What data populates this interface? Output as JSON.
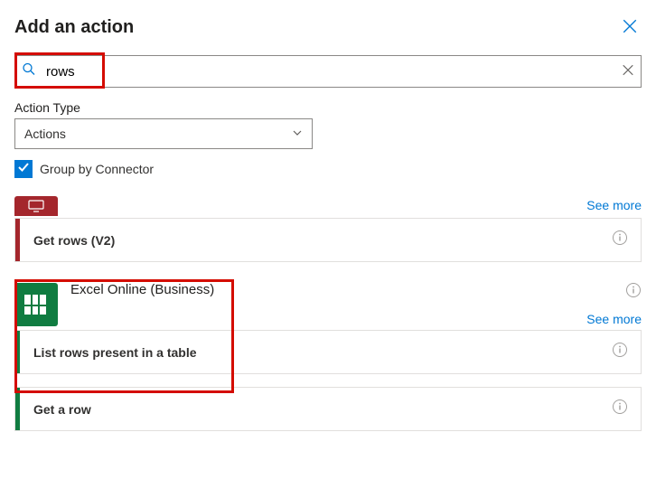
{
  "header": {
    "title": "Add an action"
  },
  "search": {
    "value": "rows"
  },
  "actionType": {
    "label": "Action Type",
    "selected": "Actions"
  },
  "groupBy": {
    "label": "Group by Connector",
    "checked": true
  },
  "links": {
    "seeMore": "See more"
  },
  "group1": {
    "actions": [
      {
        "label": "Get rows (V2)"
      }
    ]
  },
  "group2": {
    "connector": "Excel Online (Business)",
    "actions": [
      {
        "label": "List rows present in a table"
      },
      {
        "label": "Get a row"
      }
    ]
  }
}
